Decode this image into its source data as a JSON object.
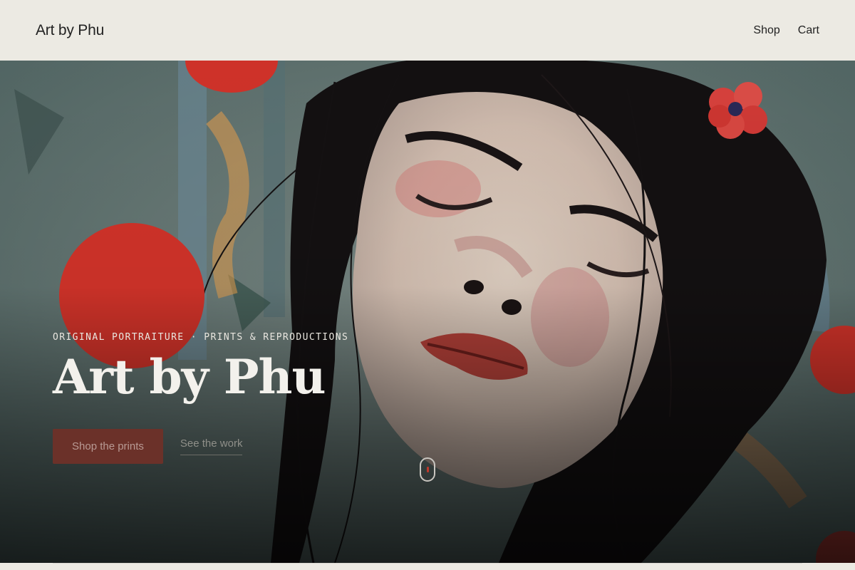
{
  "header": {
    "brand": "Art by Phu",
    "nav": [
      {
        "label": "Shop"
      },
      {
        "label": "Cart"
      }
    ]
  },
  "hero": {
    "eyebrow": "ORIGINAL PORTRAITURE · PRINTS & REPRODUCTIONS",
    "title": "Art by Phu",
    "primary_cta": "Shop the prints",
    "secondary_cta": "See the work",
    "scroll_icon": "mouse-scroll-icon"
  },
  "colors": {
    "background": "#eceae3",
    "accent_button": "#6b3129",
    "accent_red": "#d9352b"
  }
}
